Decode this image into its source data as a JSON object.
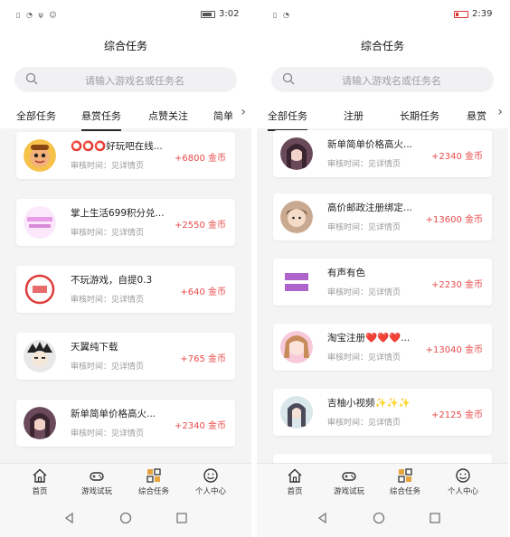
{
  "screens": [
    {
      "status": {
        "left_icons": "▯ ◔ ψ ☺",
        "time": "3:02",
        "battery_fill_fraction": 0.7
      },
      "title": "综合任务",
      "search": {
        "placeholder": "请输入游戏名或任务名"
      },
      "tabs": [
        "全部任务",
        "悬赏任务",
        "点赞关注",
        "简单"
      ],
      "active_tab": "悬赏任务",
      "tasks": [
        {
          "name": "⭕⭕⭕好玩吧在线...",
          "sub": "审核时间：见详情页",
          "reward": "+6800 金币",
          "thumb": "cartoon-avatar"
        },
        {
          "name": "掌上生活699积分兑...",
          "sub": "审核时间：见详情页",
          "reward": "+2550 金币",
          "thumb": "promo-badge"
        },
        {
          "name": "不玩游戏，自提0.3",
          "sub": "审核时间：见详情页",
          "reward": "+640 金币",
          "thumb": "seal-stamp"
        },
        {
          "name": "天翼纯下载",
          "sub": "审核时间：见详情页",
          "reward": "+765 金币",
          "thumb": "anime-avatar"
        },
        {
          "name": "新单简单价格高火...",
          "sub": "审核时间：见详情页",
          "reward": "+2340 金币",
          "thumb": "girl-avatar"
        }
      ],
      "nav": [
        "首页",
        "游戏试玩",
        "综合任务",
        "个人中心"
      ]
    },
    {
      "status": {
        "left_icons": "▯ ◔",
        "time": "2:39",
        "battery_fill_fraction": 0.15
      },
      "title": "综合任务",
      "search": {
        "placeholder": "请输入游戏名或任务名"
      },
      "tabs": [
        "全部任务",
        "注册",
        "长期任务",
        "悬赏"
      ],
      "active_tab": "全部任务",
      "tasks": [
        {
          "name": "新单简单价格高火...",
          "sub": "审核时间：见详情页",
          "reward": "+2340 金币",
          "thumb": "girl-avatar"
        },
        {
          "name": "高价邮政注册绑定...",
          "sub": "审核时间：见详情页",
          "reward": "+13600 金币",
          "thumb": "kid-avatar"
        },
        {
          "name": "有声有色",
          "sub": "审核时间：见详情页",
          "reward": "+2230 金币",
          "thumb": "purple-seal"
        },
        {
          "name": "淘宝注册❤️❤️❤️...",
          "sub": "审核时间：见详情页",
          "reward": "+13040 金币",
          "thumb": "pink-girl"
        },
        {
          "name": "吉柚小视频✨✨✨",
          "sub": "审核时间：见详情页",
          "reward": "+2125 金币",
          "thumb": "painted-girl"
        }
      ],
      "nav": [
        "首页",
        "游戏试玩",
        "综合任务",
        "个人中心"
      ]
    }
  ],
  "colors": {
    "reward": "#e74a4a",
    "active_nav": "#e6a23c"
  }
}
